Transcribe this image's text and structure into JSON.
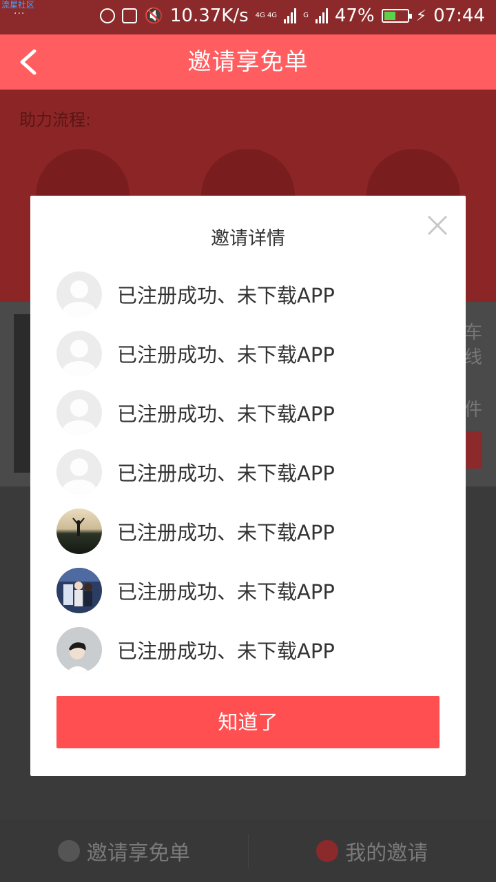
{
  "status_bar": {
    "watermark": "流星社区",
    "dots": "···",
    "speed": "10.37K/s",
    "net1": "4G 4G",
    "net2": "G",
    "battery": "47%",
    "time": "07:44"
  },
  "header": {
    "title": "邀请享免单"
  },
  "background": {
    "flow_label": "助力流程:",
    "side_texts": [
      "车",
      "线",
      "件"
    ],
    "tabs": [
      "邀请享免单",
      "我的邀请"
    ]
  },
  "modal": {
    "title": "邀请详情",
    "items": [
      {
        "status": "已注册成功、未下载APP",
        "avatar": "default-avatar"
      },
      {
        "status": "已注册成功、未下载APP",
        "avatar": "default-avatar"
      },
      {
        "status": "已注册成功、未下载APP",
        "avatar": "default-avatar"
      },
      {
        "status": "已注册成功、未下载APP",
        "avatar": "default-avatar"
      },
      {
        "status": "已注册成功、未下载APP",
        "avatar": "sunset-photo-avatar"
      },
      {
        "status": "已注册成功、未下载APP",
        "avatar": "couple-photo-avatar"
      },
      {
        "status": "已注册成功、未下载APP",
        "avatar": "portrait-photo-avatar"
      }
    ],
    "confirm_label": "知道了"
  },
  "colors": {
    "header": "#ff5d5f",
    "button": "#ff4f50",
    "status_bar": "#8c2a2b"
  }
}
